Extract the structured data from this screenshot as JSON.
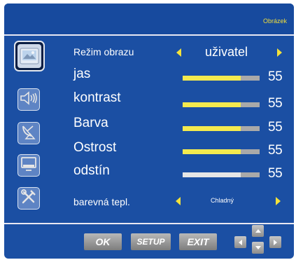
{
  "header": {
    "page_title": "Obrázek"
  },
  "sidebar": {
    "items": [
      {
        "icon": "picture-icon",
        "selected": true
      },
      {
        "icon": "speaker-icon",
        "selected": false
      },
      {
        "icon": "satellite-dish-icon",
        "selected": false
      },
      {
        "icon": "monitor-icon",
        "selected": false
      },
      {
        "icon": "tools-icon",
        "selected": false
      }
    ]
  },
  "menu": {
    "picture_mode": {
      "label": "Režim obrazu",
      "value": "uživatel"
    },
    "brightness": {
      "label": "jas",
      "value": "55",
      "level": 0.75
    },
    "contrast": {
      "label": "kontrast",
      "value": "55",
      "level": 0.75
    },
    "color": {
      "label": "Barva",
      "value": "55",
      "level": 0.75
    },
    "sharpness": {
      "label": "Ostrost",
      "value": "55",
      "level": 0.75
    },
    "tint": {
      "label": "odstín",
      "value": "55",
      "level": 0.75
    },
    "color_temperature": {
      "label": "barevná tepl.",
      "value": "Chladný"
    }
  },
  "footer": {
    "ok_label": "OK",
    "setup_label": "SETUP",
    "exit_label": "EXIT"
  },
  "colors": {
    "background": "#1b4fa3",
    "accent_yellow": "#f4e23a",
    "bar_track": "#a9a9a9",
    "tint_fill": "#e6e6e6"
  }
}
